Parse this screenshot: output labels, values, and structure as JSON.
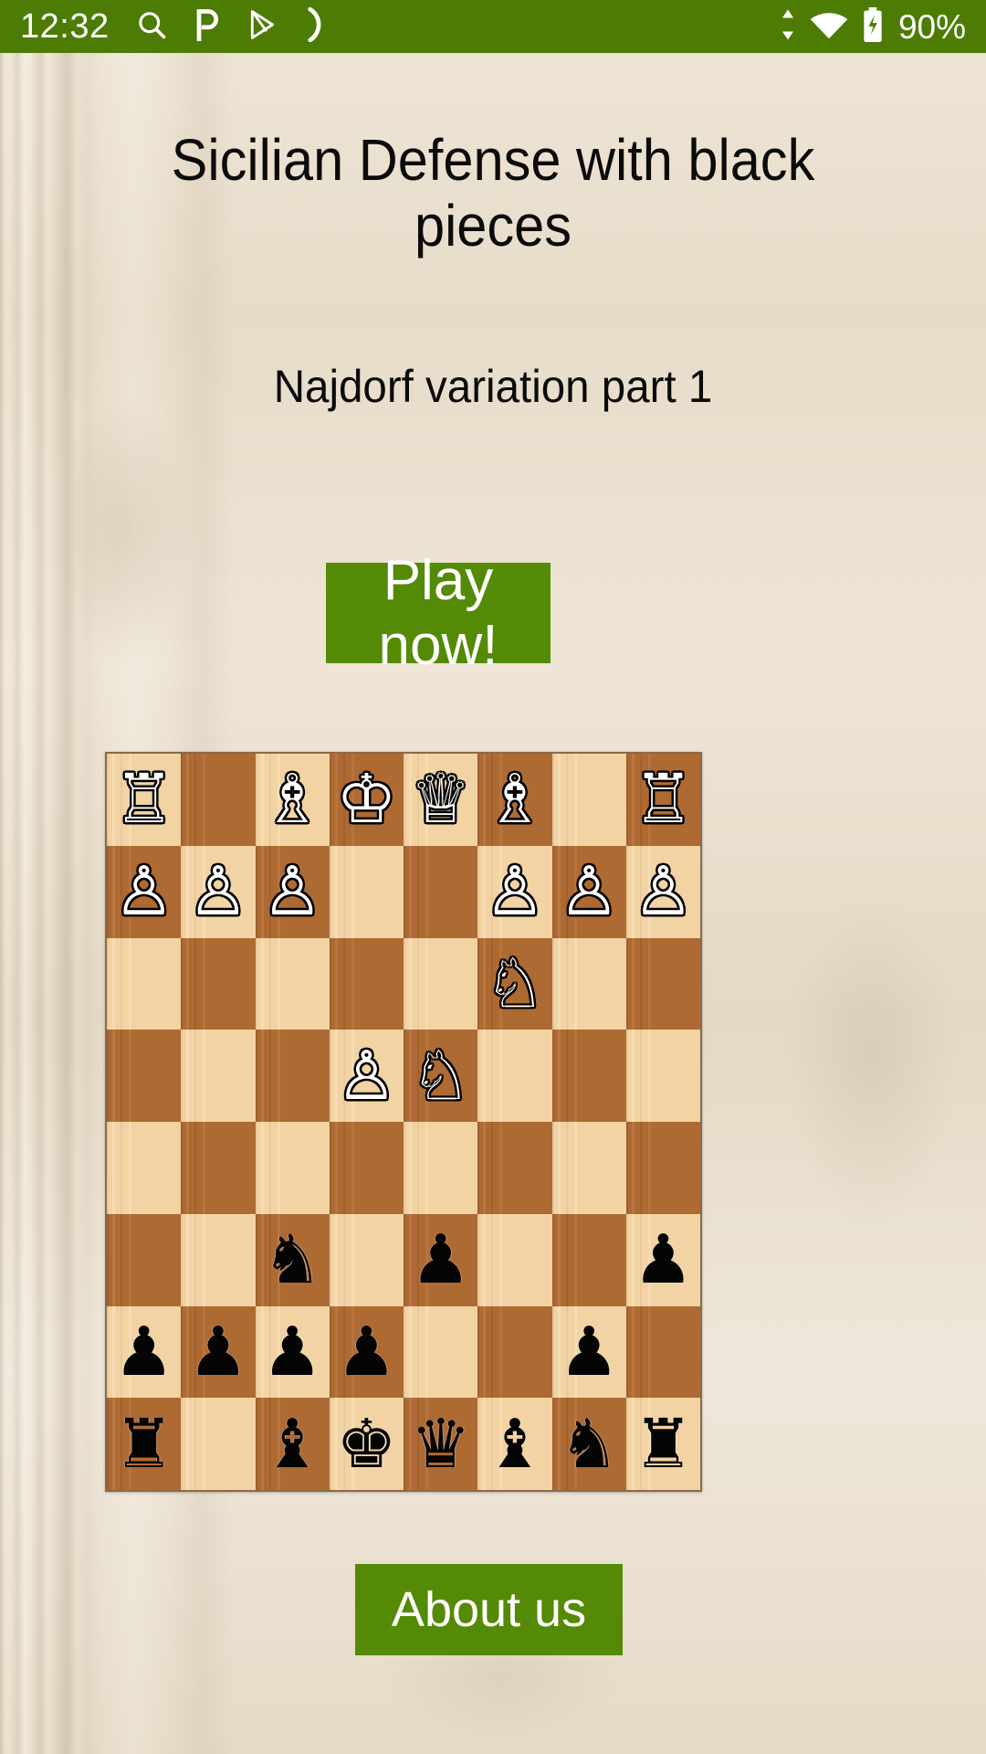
{
  "status_bar": {
    "clock": "12:32",
    "battery_percent": "90%",
    "background_color": "#4d7c05",
    "left_icons": [
      "search-icon",
      "pocket-p-icon",
      "play-store-icon",
      "do-not-disturb-moon-icon"
    ],
    "right_icons": [
      "mobile-data-arrows-icon",
      "wifi-icon",
      "battery-charging-icon"
    ]
  },
  "header": {
    "title": "Sicilian Defense with black pieces",
    "subtitle": "Najdorf variation part 1"
  },
  "buttons": {
    "play_now_label": "Play now!",
    "about_us_label": "About us",
    "accent_color": "#548a06",
    "text_color": "#ffffff"
  },
  "board": {
    "light_square_color": "#f2d3a3",
    "dark_square_color": "#ae6a33",
    "orientation": "black-at-bottom",
    "rows": [
      [
        "wR",
        "",
        "wB",
        "wK",
        "wQ",
        "wB",
        "",
        "wR"
      ],
      [
        "wP",
        "wP",
        "wP",
        "",
        "",
        "wP",
        "wP",
        "wP"
      ],
      [
        "",
        "",
        "",
        "",
        "",
        "wN",
        "",
        ""
      ],
      [
        "",
        "",
        "",
        "wP",
        "wN",
        "",
        "",
        ""
      ],
      [
        "",
        "",
        "",
        "",
        "",
        "",
        "",
        ""
      ],
      [
        "",
        "",
        "bN",
        "",
        "bP",
        "",
        "",
        "bP"
      ],
      [
        "bP",
        "bP",
        "bP",
        "bP",
        "",
        "",
        "bP",
        ""
      ],
      [
        "bR",
        "",
        "bB",
        "bK",
        "bQ",
        "bB",
        "bN",
        "bR"
      ]
    ],
    "glyphs": {
      "wK": "♔",
      "wQ": "♕",
      "wR": "♖",
      "wB": "♗",
      "wN": "♘",
      "wP": "♙",
      "bK": "♚",
      "bQ": "♛",
      "bR": "♜",
      "bB": "♝",
      "bN": "♞",
      "bP": "♟"
    }
  }
}
